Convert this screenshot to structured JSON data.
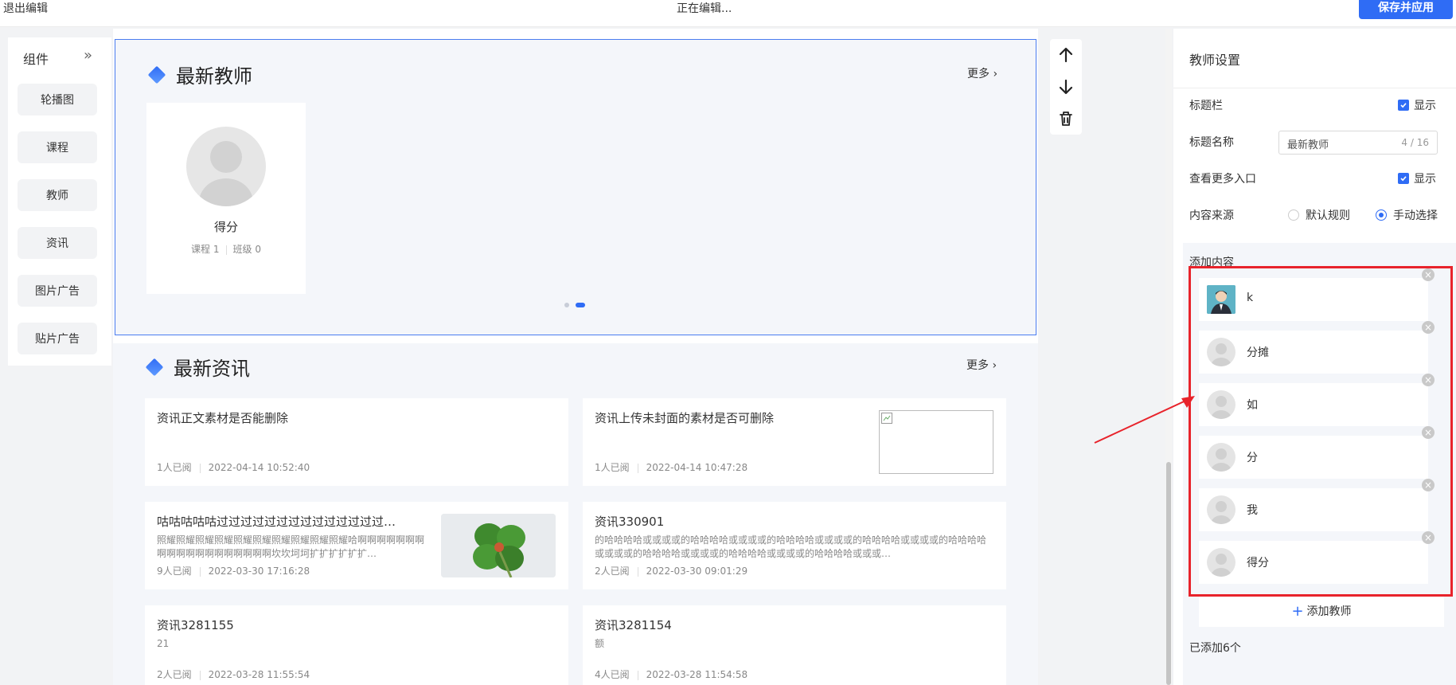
{
  "topbar": {
    "exit_label": "退出编辑",
    "status": "正在编辑...",
    "save_label": "保存并应用"
  },
  "components": {
    "title": "组件",
    "items": [
      "轮播图",
      "课程",
      "教师",
      "资讯",
      "图片广告",
      "贴片广告"
    ]
  },
  "teacher_block": {
    "title": "最新教师",
    "more": "更多 ›",
    "card": {
      "name": "得分",
      "courses": "课程 1",
      "classes": "班级 0"
    }
  },
  "news_block": {
    "title": "最新资讯",
    "more": "更多 ›",
    "items": [
      {
        "title": "资讯正文素材是否能删除",
        "summary": "",
        "reads": "1人已阅",
        "time": "2022-04-14 10:52:40"
      },
      {
        "title": "资讯上传未封面的素材是否可删除",
        "summary": "",
        "reads": "1人已阅",
        "time": "2022-04-14 10:47:28"
      },
      {
        "title": "咕咕咕咕咕过过过过过过过过过过过过过过…",
        "summary": "照耀照耀照耀照耀照耀照耀照耀照耀照耀照耀哈啊啊啊啊啊啊啊啊啊啊啊啊啊啊啊啊啊啊啊坎坎坷坷扩扩扩扩扩扩…",
        "reads": "9人已阅",
        "time": "2022-03-30 17:16:28"
      },
      {
        "title": "资讯330901",
        "summary": "的哈哈哈哈或或或或的哈哈哈哈或或或或的哈哈哈哈或或或或的哈哈哈哈或或或或的哈哈哈哈或或或或的哈哈哈哈或或或或的哈哈哈哈或或或或的哈哈哈哈或或或…",
        "reads": "2人已阅",
        "time": "2022-03-30 09:01:29"
      },
      {
        "title": "资讯3281155",
        "summary": "21",
        "reads": "2人已阅",
        "time": "2022-03-28 11:55:54"
      },
      {
        "title": "资讯3281154",
        "summary": "额",
        "reads": "4人已阅",
        "time": "2022-03-28 11:54:58"
      }
    ]
  },
  "settings": {
    "title": "教师设置",
    "title_bar_label": "标题栏",
    "show_label": "显示",
    "title_name_label": "标题名称",
    "title_name_value": "最新教师",
    "title_name_count": "4 / 16",
    "more_entry_label": "查看更多入口",
    "source_label": "内容来源",
    "source_options": [
      "默认规则",
      "手动选择"
    ],
    "source_selected": "手动选择",
    "add_content_label": "添加内容",
    "teachers": [
      "k",
      "分摊",
      "如",
      "分",
      "我",
      "得分"
    ],
    "add_teacher_label": "添加教师",
    "added_count": "已添加6个"
  },
  "colors": {
    "accent": "#2f6cf5",
    "highlight": "#e8232b"
  }
}
